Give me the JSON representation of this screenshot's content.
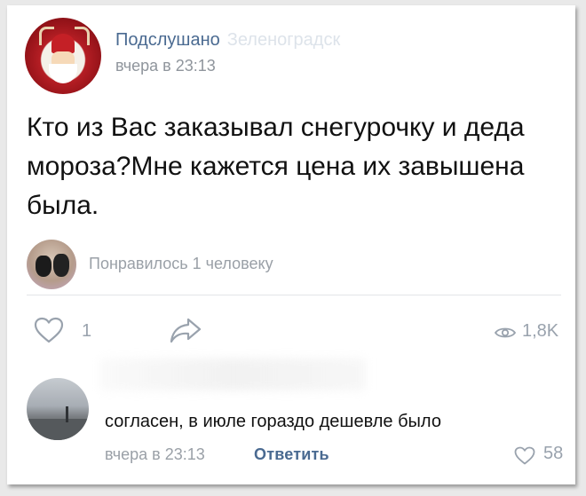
{
  "post": {
    "group_name": "Подслушано",
    "group_name_suffix": "Зеленоградск",
    "time": "вчера в 23:13",
    "text": "Кто из Вас заказывал снегурочку и деда мороза?Мне кажется цена их завышена была.",
    "liked_by": "Понравилось 1 человеку"
  },
  "actions": {
    "like_count": "1",
    "views_count": "1,8K",
    "icons": [
      "heart-outline-icon",
      "share-arrow-icon",
      "eye-icon"
    ]
  },
  "comment": {
    "text": "согласен, в июле гораздо дешевле было",
    "time": "вчера в 23:13",
    "reply_label": "Ответить",
    "like_count": "58"
  },
  "colors": {
    "link": "#4a6a91",
    "muted": "#9aa0a7",
    "icon": "#99a2ad",
    "text": "#111111"
  }
}
